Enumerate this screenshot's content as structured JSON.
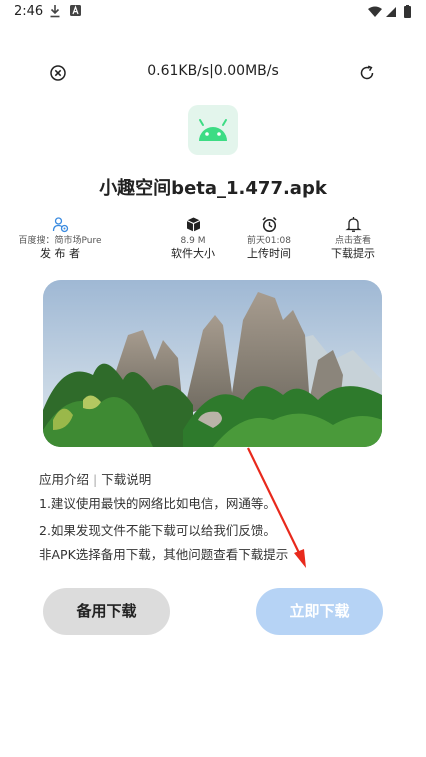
{
  "status_bar": {
    "time": "2:46"
  },
  "header": {
    "speed_text": "0.61KB/s|0.00MB/s"
  },
  "app": {
    "title": "小趣空间beta_1.477.apk"
  },
  "info": [
    {
      "icon": "publisher-icon",
      "value": "百度搜：简市场Pure",
      "label": "发 布 者"
    },
    {
      "icon": "box-icon",
      "value": "8.9 M",
      "label": "软件大小"
    },
    {
      "icon": "alarm-clock-icon",
      "value": "前天01:08",
      "label": "上传时间"
    },
    {
      "icon": "bell-icon",
      "value": "点击查看",
      "label": "下载提示"
    }
  ],
  "description": {
    "tab_intro": "应用介绍",
    "separator": "|",
    "tab_instructions": "下载说明",
    "line1": "1.建议使用最快的网络比如电信，网通等。",
    "line2": "2.如果发现文件不能下载可以给我们反馈。",
    "line3": "非APK选择备用下载，其他问题查看下载提示"
  },
  "buttons": {
    "backup_label": "备用下载",
    "download_now_label": "立即下载"
  },
  "colors": {
    "download_now_bg": "#b6d3f5",
    "backup_bg": "#dcdcdc",
    "icon_accent": "#3b8be0",
    "android_green": "#3ddc84",
    "annotation_arrow": "#e8291c"
  }
}
